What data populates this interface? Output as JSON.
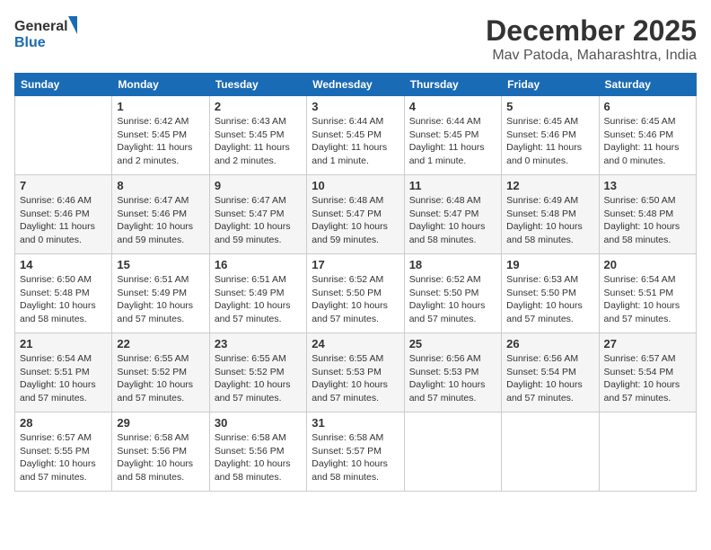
{
  "logo": {
    "line1": "General",
    "line2": "Blue"
  },
  "title": "December 2025",
  "location": "Mav Patoda, Maharashtra, India",
  "weekdays": [
    "Sunday",
    "Monday",
    "Tuesday",
    "Wednesday",
    "Thursday",
    "Friday",
    "Saturday"
  ],
  "weeks": [
    [
      {
        "day": "",
        "info": ""
      },
      {
        "day": "1",
        "info": "Sunrise: 6:42 AM\nSunset: 5:45 PM\nDaylight: 11 hours\nand 2 minutes."
      },
      {
        "day": "2",
        "info": "Sunrise: 6:43 AM\nSunset: 5:45 PM\nDaylight: 11 hours\nand 2 minutes."
      },
      {
        "day": "3",
        "info": "Sunrise: 6:44 AM\nSunset: 5:45 PM\nDaylight: 11 hours\nand 1 minute."
      },
      {
        "day": "4",
        "info": "Sunrise: 6:44 AM\nSunset: 5:45 PM\nDaylight: 11 hours\nand 1 minute."
      },
      {
        "day": "5",
        "info": "Sunrise: 6:45 AM\nSunset: 5:46 PM\nDaylight: 11 hours\nand 0 minutes."
      },
      {
        "day": "6",
        "info": "Sunrise: 6:45 AM\nSunset: 5:46 PM\nDaylight: 11 hours\nand 0 minutes."
      }
    ],
    [
      {
        "day": "7",
        "info": "Sunrise: 6:46 AM\nSunset: 5:46 PM\nDaylight: 11 hours\nand 0 minutes."
      },
      {
        "day": "8",
        "info": "Sunrise: 6:47 AM\nSunset: 5:46 PM\nDaylight: 10 hours\nand 59 minutes."
      },
      {
        "day": "9",
        "info": "Sunrise: 6:47 AM\nSunset: 5:47 PM\nDaylight: 10 hours\nand 59 minutes."
      },
      {
        "day": "10",
        "info": "Sunrise: 6:48 AM\nSunset: 5:47 PM\nDaylight: 10 hours\nand 59 minutes."
      },
      {
        "day": "11",
        "info": "Sunrise: 6:48 AM\nSunset: 5:47 PM\nDaylight: 10 hours\nand 58 minutes."
      },
      {
        "day": "12",
        "info": "Sunrise: 6:49 AM\nSunset: 5:48 PM\nDaylight: 10 hours\nand 58 minutes."
      },
      {
        "day": "13",
        "info": "Sunrise: 6:50 AM\nSunset: 5:48 PM\nDaylight: 10 hours\nand 58 minutes."
      }
    ],
    [
      {
        "day": "14",
        "info": "Sunrise: 6:50 AM\nSunset: 5:48 PM\nDaylight: 10 hours\nand 58 minutes."
      },
      {
        "day": "15",
        "info": "Sunrise: 6:51 AM\nSunset: 5:49 PM\nDaylight: 10 hours\nand 57 minutes."
      },
      {
        "day": "16",
        "info": "Sunrise: 6:51 AM\nSunset: 5:49 PM\nDaylight: 10 hours\nand 57 minutes."
      },
      {
        "day": "17",
        "info": "Sunrise: 6:52 AM\nSunset: 5:50 PM\nDaylight: 10 hours\nand 57 minutes."
      },
      {
        "day": "18",
        "info": "Sunrise: 6:52 AM\nSunset: 5:50 PM\nDaylight: 10 hours\nand 57 minutes."
      },
      {
        "day": "19",
        "info": "Sunrise: 6:53 AM\nSunset: 5:50 PM\nDaylight: 10 hours\nand 57 minutes."
      },
      {
        "day": "20",
        "info": "Sunrise: 6:54 AM\nSunset: 5:51 PM\nDaylight: 10 hours\nand 57 minutes."
      }
    ],
    [
      {
        "day": "21",
        "info": "Sunrise: 6:54 AM\nSunset: 5:51 PM\nDaylight: 10 hours\nand 57 minutes."
      },
      {
        "day": "22",
        "info": "Sunrise: 6:55 AM\nSunset: 5:52 PM\nDaylight: 10 hours\nand 57 minutes."
      },
      {
        "day": "23",
        "info": "Sunrise: 6:55 AM\nSunset: 5:52 PM\nDaylight: 10 hours\nand 57 minutes."
      },
      {
        "day": "24",
        "info": "Sunrise: 6:55 AM\nSunset: 5:53 PM\nDaylight: 10 hours\nand 57 minutes."
      },
      {
        "day": "25",
        "info": "Sunrise: 6:56 AM\nSunset: 5:53 PM\nDaylight: 10 hours\nand 57 minutes."
      },
      {
        "day": "26",
        "info": "Sunrise: 6:56 AM\nSunset: 5:54 PM\nDaylight: 10 hours\nand 57 minutes."
      },
      {
        "day": "27",
        "info": "Sunrise: 6:57 AM\nSunset: 5:54 PM\nDaylight: 10 hours\nand 57 minutes."
      }
    ],
    [
      {
        "day": "28",
        "info": "Sunrise: 6:57 AM\nSunset: 5:55 PM\nDaylight: 10 hours\nand 57 minutes."
      },
      {
        "day": "29",
        "info": "Sunrise: 6:58 AM\nSunset: 5:56 PM\nDaylight: 10 hours\nand 58 minutes."
      },
      {
        "day": "30",
        "info": "Sunrise: 6:58 AM\nSunset: 5:56 PM\nDaylight: 10 hours\nand 58 minutes."
      },
      {
        "day": "31",
        "info": "Sunrise: 6:58 AM\nSunset: 5:57 PM\nDaylight: 10 hours\nand 58 minutes."
      },
      {
        "day": "",
        "info": ""
      },
      {
        "day": "",
        "info": ""
      },
      {
        "day": "",
        "info": ""
      }
    ]
  ]
}
